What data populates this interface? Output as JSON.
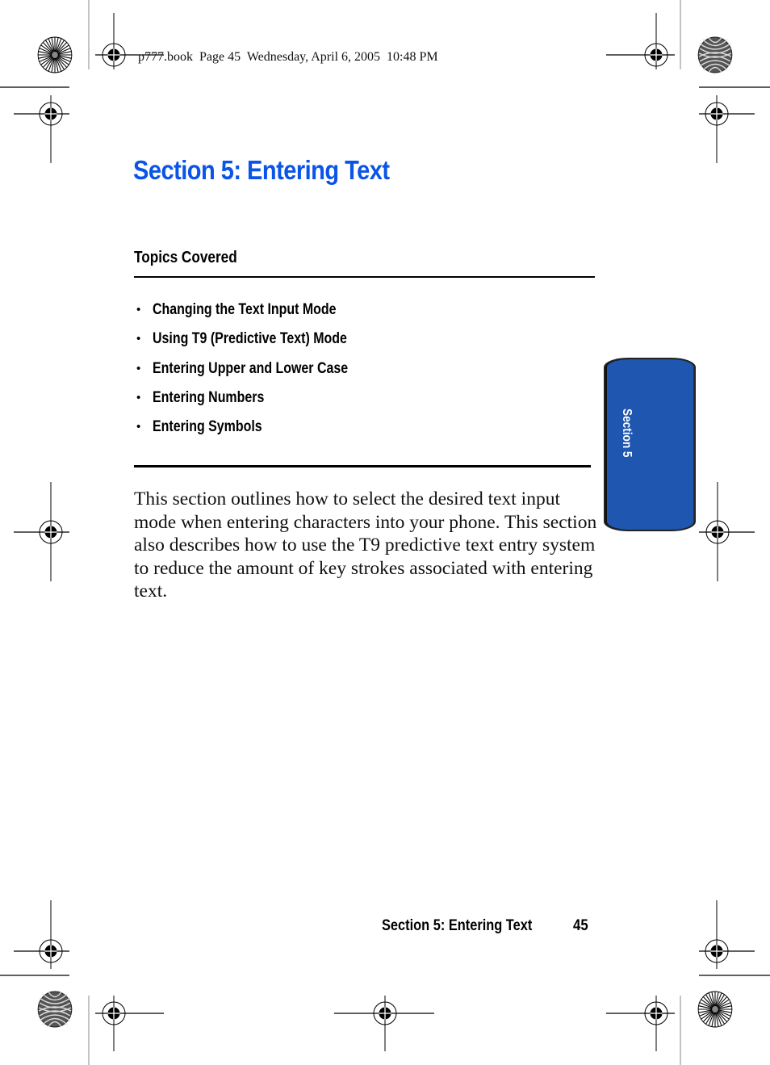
{
  "print_header": {
    "text": "p777.book  Page 45  Wednesday, April 6, 2005  10:48 PM"
  },
  "page": {
    "section_title": "Section 5: Entering Text",
    "topics_heading": "Topics Covered",
    "topics": [
      {
        "bullet": "•",
        "label": "Changing the Text Input Mode"
      },
      {
        "bullet": "•",
        "label": "Using T9 (Predictive Text) Mode"
      },
      {
        "bullet": "•",
        "label": "Entering Upper and Lower Case"
      },
      {
        "bullet": "•",
        "label": "Entering Numbers"
      },
      {
        "bullet": "•",
        "label": "Entering Symbols"
      }
    ],
    "intro_paragraph": "This section outlines how to select the desired text input mode when entering characters into your phone. This section also describes how to use the T9 predictive text entry system to reduce the amount of key strokes associated with entering text."
  },
  "section_tab": {
    "label": "Section 5",
    "color": "#1e56b0"
  },
  "footer": {
    "running_title": "Section 5: Entering Text",
    "page_number": "45"
  },
  "colors": {
    "title_blue": "#0a55e8",
    "tab_blue": "#1e56b0",
    "text": "#000000"
  },
  "icons": {
    "registration_mark": "crosshair-target-icon",
    "star_target": "starburst-target-icon",
    "moire_target": "moire-target-icon"
  }
}
